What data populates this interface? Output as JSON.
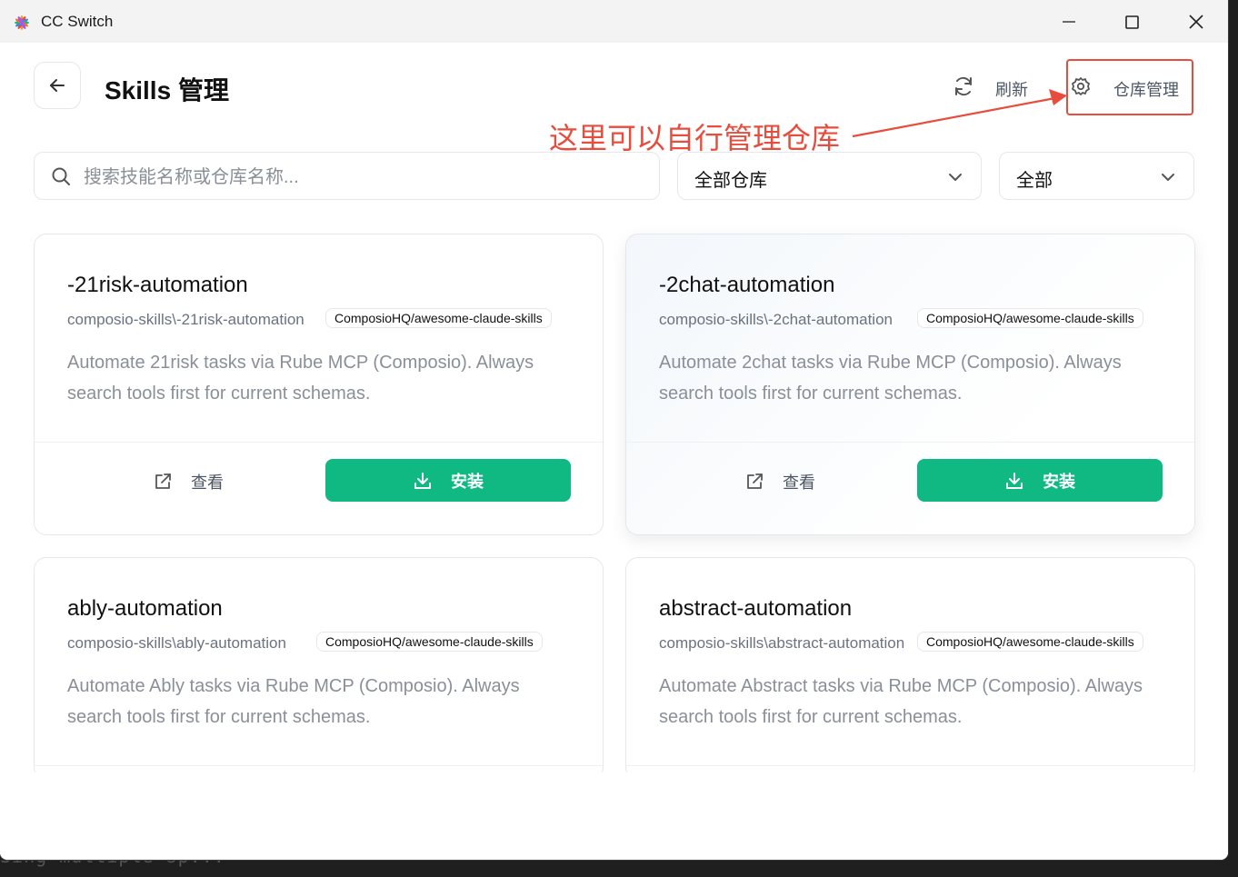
{
  "window": {
    "title": "CC Switch"
  },
  "header": {
    "title": "Skills 管理",
    "refresh_label": "刷新",
    "repo_manage_label": "仓库管理"
  },
  "annotation": {
    "text": "这里可以自行管理仓库",
    "color": "#e74c3c"
  },
  "filters": {
    "search_placeholder": "搜索技能名称或仓库名称...",
    "repo_select": "全部仓库",
    "status_select": "全部"
  },
  "cards": [
    {
      "title": "-21risk-automation",
      "path": "composio-skills\\-21risk-automation",
      "repo": "ComposioHQ/awesome-claude-skills",
      "description": "Automate 21risk tasks via Rube MCP (Composio). Always search tools first for current schemas.",
      "view_label": "查看",
      "install_label": "安装"
    },
    {
      "title": "-2chat-automation",
      "path": "composio-skills\\-2chat-automation",
      "repo": "ComposioHQ/awesome-claude-skills",
      "description": "Automate 2chat tasks via Rube MCP (Composio). Always search tools first for current schemas.",
      "view_label": "查看",
      "install_label": "安装"
    },
    {
      "title": "ably-automation",
      "path": "composio-skills\\ably-automation",
      "repo": "ComposioHQ/awesome-claude-skills",
      "description": "Automate Ably tasks via Rube MCP (Composio). Always search tools first for current schemas."
    },
    {
      "title": "abstract-automation",
      "path": "composio-skills\\abstract-automation",
      "repo": "ComposioHQ/awesome-claude-skills",
      "description": "Automate Abstract tasks via Rube MCP (Composio). Always search tools first for current schemas."
    }
  ],
  "background": {
    "terminal_text": "Sing multiple sp..."
  },
  "colors": {
    "accent": "#10b981",
    "annotation": "#e74c3c"
  }
}
